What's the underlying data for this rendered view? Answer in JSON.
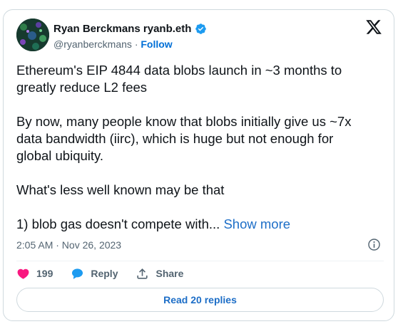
{
  "author": {
    "display_name": "Ryan Berckmans ryanb.eth",
    "handle": "@ryanberckmans",
    "separator": "·",
    "follow_label": "Follow",
    "verified": true,
    "avatar_icon": "avatar-image"
  },
  "header": {
    "logo_icon": "x-logo-icon"
  },
  "tweet": {
    "lines": [
      "Ethereum's EIP 4844 data blobs launch in ~3 months to",
      "greatly reduce L2 fees",
      "By now, many people know that blobs initially give us ~7x",
      "data bandwidth (iirc), which is huge but not enough for",
      "global ubiquity.",
      "What's less well known may be that",
      "1) blob gas doesn't compete with..."
    ],
    "show_more_label": "Show more"
  },
  "meta": {
    "timestamp": "2:05 AM · Nov 26, 2023",
    "info_icon": "info-icon"
  },
  "actions": {
    "like_count": "199",
    "reply_label": "Reply",
    "share_label": "Share"
  },
  "footer": {
    "read_replies_label": "Read 20 replies"
  },
  "colors": {
    "accent": "#1d9bf0",
    "link": "#1d6ec7",
    "like": "#f91880",
    "muted": "#536471",
    "border": "#cfd9de"
  }
}
